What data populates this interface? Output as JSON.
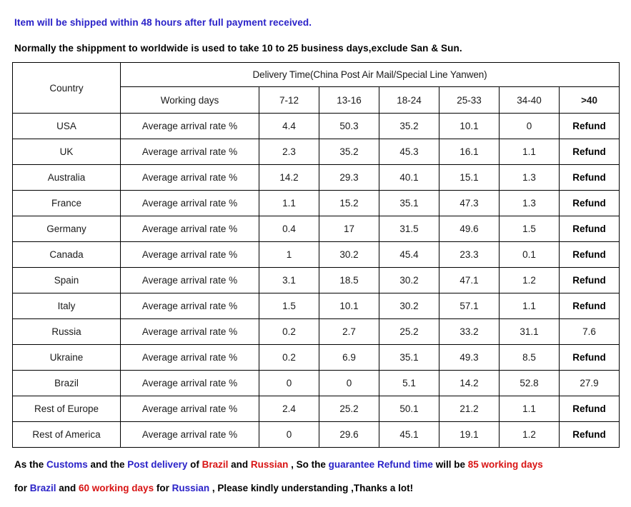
{
  "notices": {
    "shipping_notice": "Item will be shipped within 48 hours after full payment received.",
    "delivery_notice": "Normally the shippment to worldwide is used to take 10 to 25 business days,exclude San & Sun."
  },
  "colors": {
    "blue": "#2A22C8",
    "red": "#D81414",
    "border": "#000000",
    "text": "#1a1a1a"
  },
  "table": {
    "country_header": "Country",
    "group_header": "Delivery Time(China Post Air Mail/Special Line Yanwen)",
    "working_days_header": "Working days",
    "day_bands": [
      "7-12",
      "13-16",
      "18-24",
      "25-33",
      "34-40",
      ">40"
    ],
    "metric_label": "Average arrival rate %",
    "rows": [
      {
        "country": "USA",
        "values": [
          "4.4",
          "50.3",
          "35.2",
          "10.1",
          "0",
          "Refund"
        ]
      },
      {
        "country": "UK",
        "values": [
          "2.3",
          "35.2",
          "45.3",
          "16.1",
          "1.1",
          "Refund"
        ]
      },
      {
        "country": "Australia",
        "values": [
          "14.2",
          "29.3",
          "40.1",
          "15.1",
          "1.3",
          "Refund"
        ]
      },
      {
        "country": "France",
        "values": [
          "1.1",
          "15.2",
          "35.1",
          "47.3",
          "1.3",
          "Refund"
        ]
      },
      {
        "country": "Germany",
        "values": [
          "0.4",
          "17",
          "31.5",
          "49.6",
          "1.5",
          "Refund"
        ]
      },
      {
        "country": "Canada",
        "values": [
          "1",
          "30.2",
          "45.4",
          "23.3",
          "0.1",
          "Refund"
        ]
      },
      {
        "country": "Spain",
        "values": [
          "3.1",
          "18.5",
          "30.2",
          "47.1",
          "1.2",
          "Refund"
        ]
      },
      {
        "country": "Italy",
        "values": [
          "1.5",
          "10.1",
          "30.2",
          "57.1",
          "1.1",
          "Refund"
        ]
      },
      {
        "country": "Russia",
        "values": [
          "0.2",
          "2.7",
          "25.2",
          "33.2",
          "31.1",
          "7.6"
        ]
      },
      {
        "country": "Ukraine",
        "values": [
          "0.2",
          "6.9",
          "35.1",
          "49.3",
          "8.5",
          "Refund"
        ]
      },
      {
        "country": "Brazil",
        "values": [
          "0",
          "0",
          "5.1",
          "14.2",
          "52.8",
          "27.9"
        ]
      },
      {
        "country": "Rest of Europe",
        "values": [
          "2.4",
          "25.2",
          "50.1",
          "21.2",
          "1.1",
          "Refund"
        ]
      },
      {
        "country": "Rest of America",
        "values": [
          "0",
          "29.6",
          "45.1",
          "19.1",
          "1.2",
          "Refund"
        ]
      }
    ]
  },
  "footer": {
    "line1": [
      {
        "text": "As the ",
        "color": "black"
      },
      {
        "text": "Customs",
        "color": "blue"
      },
      {
        "text": " and the ",
        "color": "black"
      },
      {
        "text": "Post delivery",
        "color": "blue"
      },
      {
        "text": " of ",
        "color": "black"
      },
      {
        "text": "Brazil",
        "color": "red"
      },
      {
        "text": " and ",
        "color": "black"
      },
      {
        "text": "Russian",
        "color": "red"
      },
      {
        "text": " , So the ",
        "color": "black"
      },
      {
        "text": "guarantee Refund time",
        "color": "blue"
      },
      {
        "text": " will be ",
        "color": "black"
      },
      {
        "text": "85 working days",
        "color": "red"
      }
    ],
    "line2": [
      {
        "text": "for ",
        "color": "black"
      },
      {
        "text": "Brazil",
        "color": "blue"
      },
      {
        "text": " and ",
        "color": "black"
      },
      {
        "text": "60 working days",
        "color": "red"
      },
      {
        "text": " for ",
        "color": "black"
      },
      {
        "text": "Russian",
        "color": "blue"
      },
      {
        "text": " , Please kindly understanding ,Thanks a lot!",
        "color": "black"
      }
    ]
  }
}
